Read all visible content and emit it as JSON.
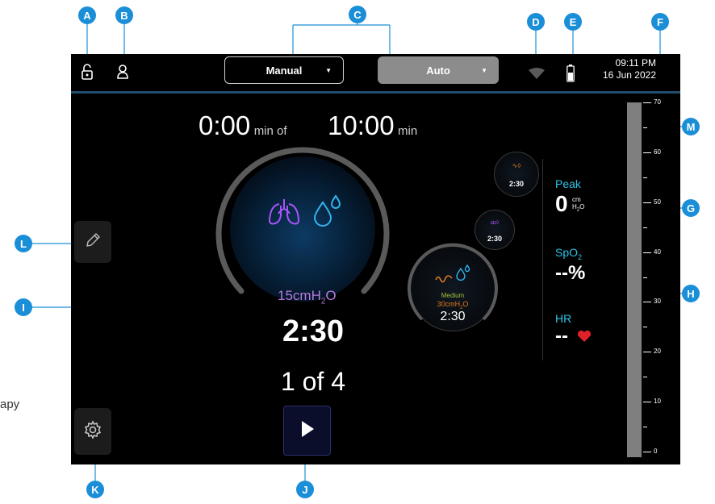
{
  "callouts": [
    "A",
    "B",
    "C",
    "D",
    "E",
    "F",
    "G",
    "H",
    "I",
    "J",
    "K",
    "L",
    "M"
  ],
  "caption": "apy",
  "topbar": {
    "manual_label": "Manual",
    "auto_label": "Auto",
    "time": "09:11 PM",
    "date": "16 Jun 2022",
    "icons": [
      "unlock-icon",
      "user-icon",
      "wifi-icon",
      "battery-icon"
    ]
  },
  "timer": {
    "elapsed": "0:00",
    "elapsed_unit": "min of",
    "total": "10:00",
    "total_unit": "min"
  },
  "main": {
    "pressure": "15cmH",
    "pressure_sub": "2",
    "pressure_suffix": "O",
    "duration": "2:30",
    "step": "1 of 4",
    "icons": [
      "lungs-icon",
      "droplet-icon",
      "play-icon",
      "pencil-icon",
      "gear-icon"
    ]
  },
  "queue": [
    {
      "label": "Medium",
      "pressure": "30cmH",
      "pressure_sub": "2",
      "pressure_suffix": "O",
      "duration": "2:30"
    },
    {
      "duration": "2:30"
    },
    {
      "duration": "2:30"
    }
  ],
  "vitals": {
    "peak_label": "Peak",
    "peak_value": "0",
    "peak_unit_top": "cm",
    "peak_unit_bottom": "H",
    "peak_unit_sub": "2",
    "peak_unit_end": "O",
    "spo2_label": "SpO",
    "spo2_sub": "2",
    "spo2_value": "--%",
    "hr_label": "HR",
    "hr_value": "--"
  },
  "gauge": {
    "labels": [
      "70",
      "60",
      "50",
      "40",
      "30",
      "20",
      "10",
      "0"
    ],
    "level": 0
  },
  "colors": {
    "accent_blue": "#1a8fd8",
    "pressure_purple": "#b77ae0",
    "vital_cyan": "#2ec4e8",
    "heart_red": "#e0202a",
    "medium_orange": "#e07a1f"
  }
}
